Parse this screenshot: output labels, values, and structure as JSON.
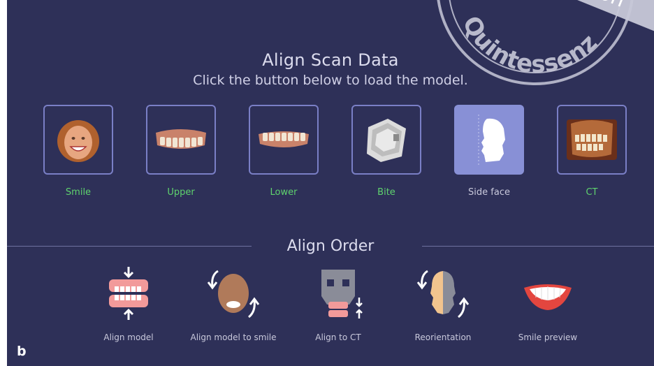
{
  "header": {
    "title": "Align Scan Data",
    "subtitle": "Click the button below to load the model."
  },
  "scan_tiles": [
    {
      "label": "Smile",
      "icon": "smile-photo-icon",
      "loaded": true
    },
    {
      "label": "Upper",
      "icon": "upper-teeth-icon",
      "loaded": true
    },
    {
      "label": "Lower",
      "icon": "lower-teeth-icon",
      "loaded": true
    },
    {
      "label": "Bite",
      "icon": "bite-scan-icon",
      "loaded": true
    },
    {
      "label": "Side face",
      "icon": "side-face-icon",
      "loaded": false
    },
    {
      "label": "CT",
      "icon": "ct-scan-icon",
      "loaded": true
    }
  ],
  "align_order": {
    "title": "Align Order",
    "steps": [
      {
        "label": "Align model",
        "icon": "align-model-icon"
      },
      {
        "label": "Align model to smile",
        "icon": "align-model-to-smile-icon"
      },
      {
        "label": "Align to CT",
        "icon": "align-to-ct-icon"
      },
      {
        "label": "Reorientation",
        "icon": "reorientation-icon"
      },
      {
        "label": "Smile preview",
        "icon": "smile-preview-icon"
      }
    ]
  },
  "figure_label": "b",
  "watermark": {
    "text": "Quintessenz",
    "banner": "ication"
  },
  "colors": {
    "background": "#2e3058",
    "tile_border": "#7a7fc6",
    "loaded_label": "#5fd36e",
    "inactive_label": "#c9c9dc",
    "active_tile_bg": "#8890d6"
  }
}
